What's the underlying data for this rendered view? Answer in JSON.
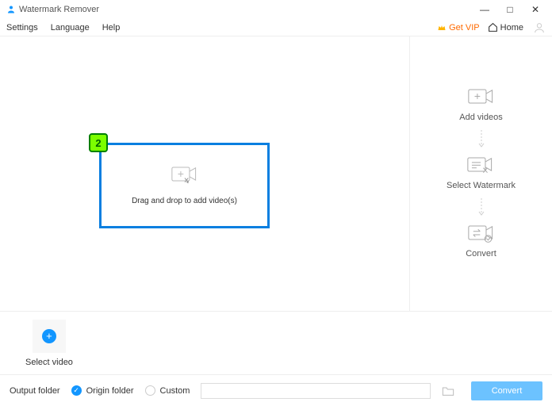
{
  "titlebar": {
    "title": "Watermark Remover"
  },
  "menubar": {
    "settings": "Settings",
    "language": "Language",
    "help": "Help",
    "get_vip": "Get VIP",
    "home": "Home"
  },
  "drop": {
    "text": "Drag and drop to add video(s)",
    "callout_num": "2"
  },
  "steps": {
    "add": "Add videos",
    "select": "Select Watermark",
    "convert": "Convert"
  },
  "bottom": {
    "select_video": "Select video"
  },
  "footer": {
    "output_label": "Output folder",
    "origin": "Origin folder",
    "custom": "Custom",
    "path_value": "",
    "convert_btn": "Convert"
  }
}
